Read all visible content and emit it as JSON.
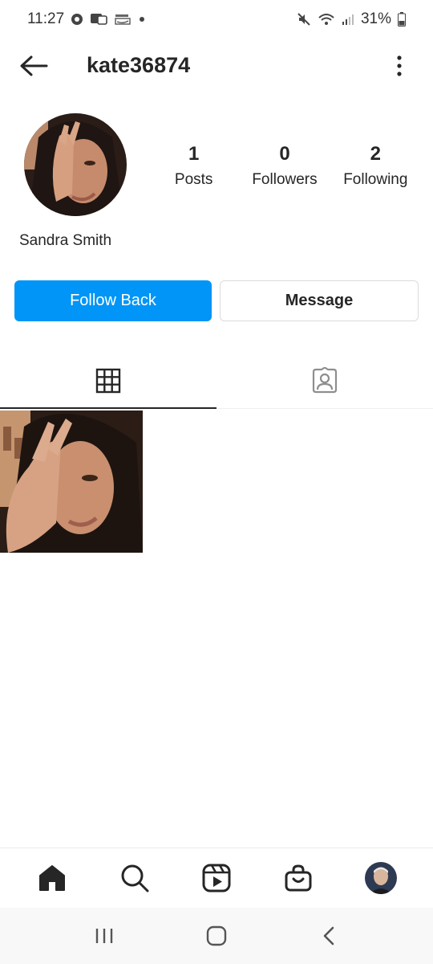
{
  "status_bar": {
    "time": "11:27",
    "battery": "31%",
    "icons": [
      "notification-dot-icon",
      "message-icon",
      "amazon-icon",
      "dot-icon",
      "mute-icon",
      "wifi-icon",
      "signal-icon",
      "battery-icon"
    ]
  },
  "header": {
    "username": "kate36874",
    "back_icon": "arrow-left-icon",
    "menu_icon": "more-vertical-icon"
  },
  "profile": {
    "display_name": "Sandra Smith",
    "stats": [
      {
        "value": "1",
        "label": "Posts"
      },
      {
        "value": "0",
        "label": "Followers"
      },
      {
        "value": "2",
        "label": "Following"
      }
    ]
  },
  "actions": {
    "follow_back": "Follow Back",
    "message": "Message"
  },
  "tabs": [
    {
      "icon": "grid-icon",
      "active": true
    },
    {
      "icon": "tagged-person-icon",
      "active": false
    }
  ],
  "bottom_nav": [
    "home-icon",
    "search-icon",
    "reels-icon",
    "shop-icon",
    "profile-avatar"
  ],
  "system_nav": [
    "recent-apps-icon",
    "home-button-icon",
    "back-chevron-icon"
  ],
  "colors": {
    "primary": "#0095f6",
    "text": "#262626",
    "border": "#dbdbdb"
  }
}
